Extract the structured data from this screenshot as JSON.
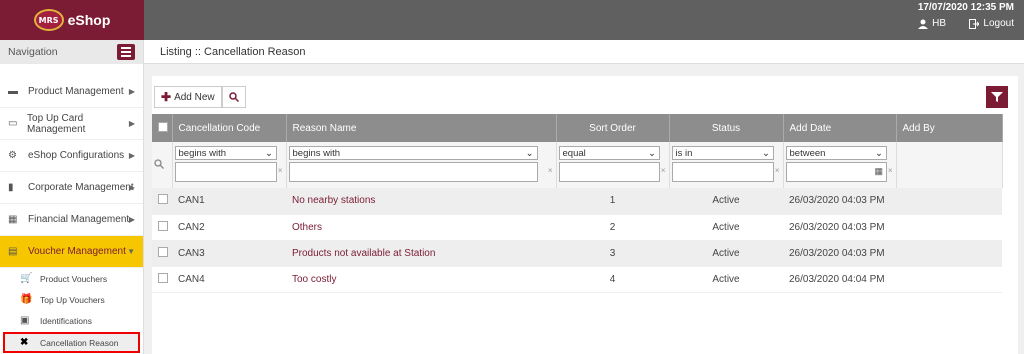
{
  "header": {
    "brand_badge": "MRS",
    "brand_name": "eShop",
    "datetime": "17/07/2020 12:35 PM",
    "user": "HB",
    "logout": "Logout"
  },
  "sidebar": {
    "title": "Navigation",
    "items": [
      {
        "label": "Product Management",
        "icon": "box-icon"
      },
      {
        "label": "Top Up Card Management",
        "icon": "card-icon"
      },
      {
        "label": "eShop Configurations",
        "icon": "gear-icon"
      },
      {
        "label": "Corporate Management",
        "icon": "chart-icon"
      },
      {
        "label": "Financial Management",
        "icon": "grid-icon"
      },
      {
        "label": "Voucher Management",
        "icon": "voucher-icon"
      }
    ],
    "sub_items": [
      {
        "label": "Product Vouchers",
        "icon": "cart-icon"
      },
      {
        "label": "Top Up Vouchers",
        "icon": "gift-icon"
      },
      {
        "label": "Identifications",
        "icon": "id-card-icon"
      },
      {
        "label": "Cancellation Reason",
        "icon": "x-icon"
      }
    ]
  },
  "main": {
    "title": "Listing :: Cancellation Reason",
    "add_new": "Add New",
    "columns": [
      "Cancellation Code",
      "Reason Name",
      "Sort Order",
      "Status",
      "Add Date",
      "Add By"
    ],
    "filters": [
      "begins with",
      "begins with",
      "equal",
      "is in",
      "between"
    ],
    "rows": [
      {
        "code": "CAN1",
        "reason": "No nearby stations",
        "sort": "1",
        "status": "Active",
        "date": "26/03/2020 04:03 PM"
      },
      {
        "code": "CAN2",
        "reason": "Others",
        "sort": "2",
        "status": "Active",
        "date": "26/03/2020 04:03 PM"
      },
      {
        "code": "CAN3",
        "reason": "Products not available at Station",
        "sort": "3",
        "status": "Active",
        "date": "26/03/2020 04:03 PM"
      },
      {
        "code": "CAN4",
        "reason": "Too costly",
        "sort": "4",
        "status": "Active",
        "date": "26/03/2020 04:04 PM"
      }
    ]
  }
}
